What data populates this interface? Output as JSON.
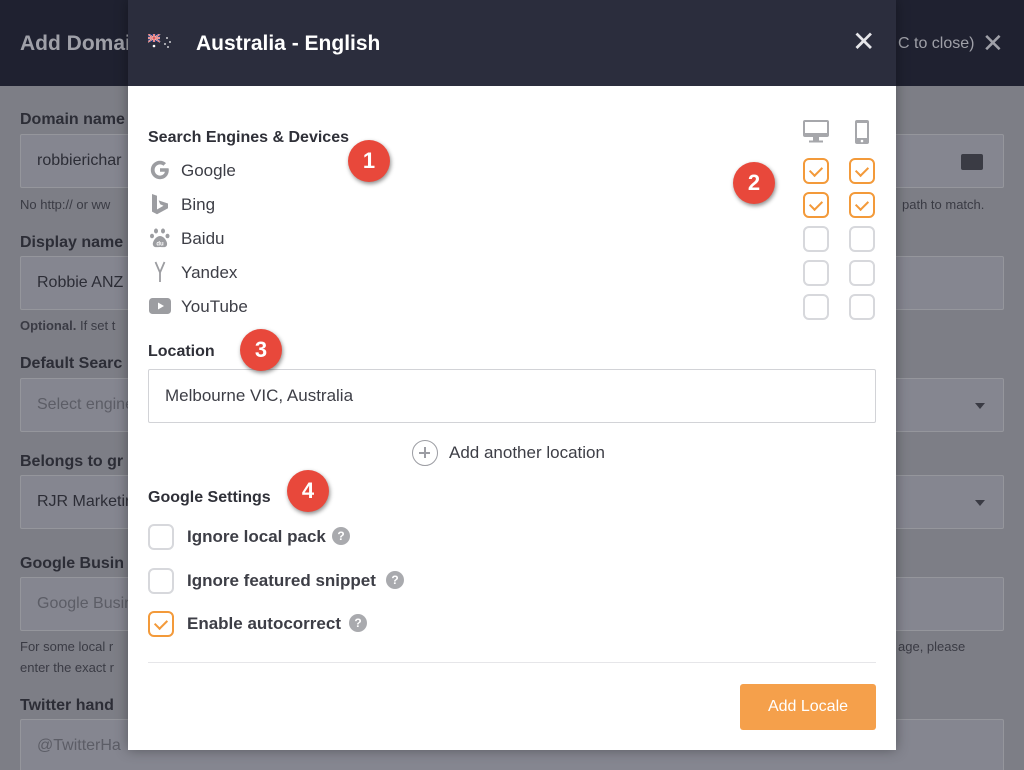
{
  "background": {
    "title": "Add Domai",
    "esc_hint": "C to close)",
    "fields": [
      {
        "label": "Domain name",
        "value": "robbierichar"
      },
      {
        "label": "Display name",
        "value": "Robbie ANZ"
      },
      {
        "label": "Default Searc",
        "value": "Select engine"
      },
      {
        "label": "Belongs to gr",
        "value": "RJR Marketir"
      },
      {
        "label": "Google Busin",
        "value": "Google Busir"
      },
      {
        "label": "Twitter hand",
        "value": "@TwitterHa"
      }
    ],
    "hint_domain_left": "No http:// or ww",
    "hint_domain_right": "path to match.",
    "hint_display_bold": "Optional.",
    "hint_display_rest": "If set t",
    "hint_gmb_left_1": "For some local r",
    "hint_gmb_left_2": "enter the exact r",
    "hint_gmb_right": "age, please"
  },
  "modal": {
    "title": "Australia - English",
    "close_symbol": "✕",
    "engines_heading": "Search Engines & Devices",
    "engines": [
      {
        "name": "Google",
        "icon": "google-icon",
        "desktop": true,
        "mobile": true
      },
      {
        "name": "Bing",
        "icon": "bing-icon",
        "desktop": true,
        "mobile": true
      },
      {
        "name": "Baidu",
        "icon": "baidu-icon",
        "desktop": false,
        "mobile": false
      },
      {
        "name": "Yandex",
        "icon": "yandex-icon",
        "desktop": false,
        "mobile": false
      },
      {
        "name": "YouTube",
        "icon": "youtube-icon",
        "desktop": false,
        "mobile": false
      }
    ],
    "location_heading": "Location",
    "location_value": "Melbourne VIC, Australia",
    "add_location_label": "Add another location",
    "google_settings_heading": "Google Settings",
    "google_settings": [
      {
        "label": "Ignore local pack",
        "checked": false
      },
      {
        "label": "Ignore featured snippet",
        "checked": false
      },
      {
        "label": "Enable autocorrect",
        "checked": true
      }
    ],
    "help_symbol": "?",
    "add_button_label": "Add Locale"
  },
  "badges": [
    "1",
    "2",
    "3",
    "4"
  ],
  "colors": {
    "accent": "#f5a04b",
    "checkbox_on": "#f39a3a",
    "badge": "#e8483b",
    "header": "#2b2d3d"
  }
}
